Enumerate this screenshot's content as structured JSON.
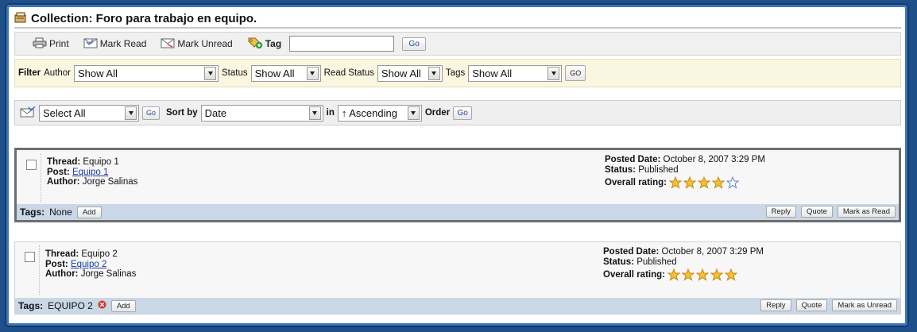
{
  "header": {
    "title": "Collection: Foro para trabajo en equipo."
  },
  "toolbar": {
    "print_label": "Print",
    "mark_read_label": "Mark Read",
    "mark_unread_label": "Mark Unread",
    "tag_label": "Tag",
    "tag_value": "",
    "go_label": "Go"
  },
  "filter": {
    "filter_label": "Filter",
    "author_label": "Author",
    "author_value": "Show All",
    "status_label": "Status",
    "status_value": "Show All",
    "read_status_label": "Read Status",
    "read_status_value": "Show All",
    "tags_label": "Tags",
    "tags_value": "Show All",
    "go_label": "GO"
  },
  "sortbar": {
    "select_value": "Select All",
    "go_label": "Go",
    "sort_by_label": "Sort by",
    "sort_by_value": "Date",
    "in_label": "in",
    "order_value": "↑ Ascending",
    "order_label": "Order",
    "order_go_label": "Go"
  },
  "posts": [
    {
      "thread_label": "Thread:",
      "thread": "Equipo 1",
      "post_label": "Post:",
      "post": "Equipo 1",
      "author_label": "Author:",
      "author": "Jorge Salinas",
      "posted_label": "Posted Date:",
      "posted": "October 8, 2007 3:29 PM",
      "status_label": "Status:",
      "status": "Published",
      "rating_label": "Overall rating:",
      "rating": 4,
      "rating_max": 5,
      "tags_label": "Tags:",
      "tags": "None",
      "add_label": "Add",
      "reply_label": "Reply",
      "quote_label": "Quote",
      "mark_label": "Mark as Read"
    },
    {
      "thread_label": "Thread:",
      "thread": "Equipo 2",
      "post_label": "Post:",
      "post": "Equipo 2",
      "author_label": "Author:",
      "author": "Jorge Salinas",
      "posted_label": "Posted Date:",
      "posted": "October 8, 2007 3:29 PM",
      "status_label": "Status:",
      "status": "Published",
      "rating_label": "Overall rating:",
      "rating": 5,
      "rating_max": 5,
      "tags_label": "Tags:",
      "tags": "EQUIPO 2",
      "add_label": "Add",
      "reply_label": "Reply",
      "quote_label": "Quote",
      "mark_label": "Mark as Unread"
    }
  ],
  "colors": {
    "star_fill": "#f2c230",
    "star_empty": "#ffffff",
    "star_outline": "#c58a13",
    "star_empty_outline": "#5a84c7",
    "remove_tag": "#d7362b"
  }
}
